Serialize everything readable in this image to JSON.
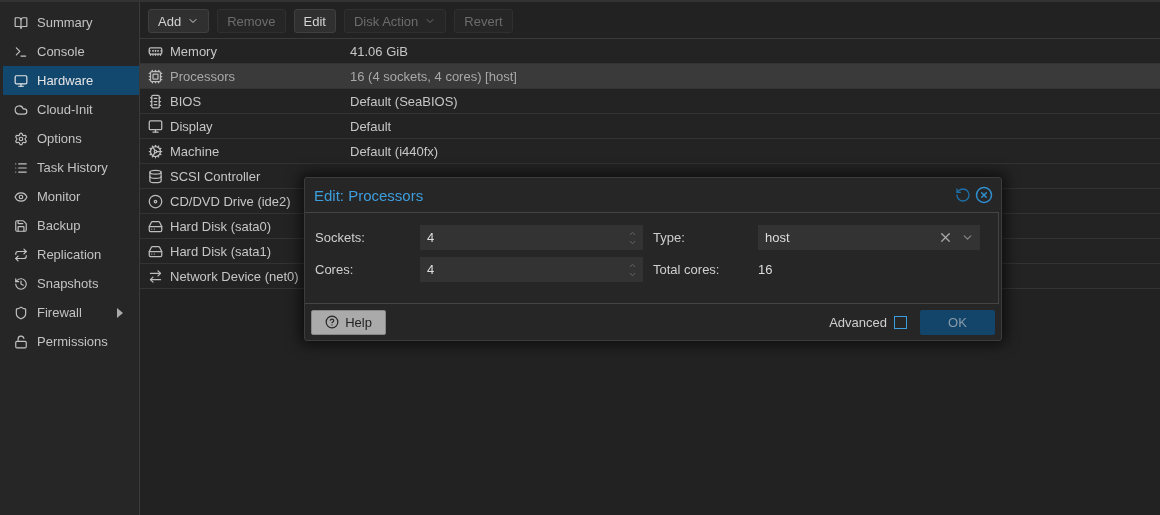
{
  "sidebar": {
    "items": [
      {
        "label": "Summary",
        "selected": false
      },
      {
        "label": "Console",
        "selected": false
      },
      {
        "label": "Hardware",
        "selected": true
      },
      {
        "label": "Cloud-Init",
        "selected": false
      },
      {
        "label": "Options",
        "selected": false
      },
      {
        "label": "Task History",
        "selected": false
      },
      {
        "label": "Monitor",
        "selected": false
      },
      {
        "label": "Backup",
        "selected": false
      },
      {
        "label": "Replication",
        "selected": false
      },
      {
        "label": "Snapshots",
        "selected": false
      },
      {
        "label": "Firewall",
        "selected": false,
        "expandable": true
      },
      {
        "label": "Permissions",
        "selected": false
      }
    ]
  },
  "toolbar": {
    "buttons": [
      {
        "label": "Add",
        "disabled": false,
        "dropdown": true
      },
      {
        "label": "Remove",
        "disabled": true,
        "dropdown": false
      },
      {
        "label": "Edit",
        "disabled": false,
        "dropdown": false
      },
      {
        "label": "Disk Action",
        "disabled": true,
        "dropdown": true
      },
      {
        "label": "Revert",
        "disabled": true,
        "dropdown": false
      }
    ]
  },
  "hardware": {
    "rows": [
      {
        "name": "Memory",
        "value": "41.06 GiB",
        "selected": false
      },
      {
        "name": "Processors",
        "value": "16 (4 sockets, 4 cores) [host]",
        "selected": true
      },
      {
        "name": "BIOS",
        "value": "Default (SeaBIOS)",
        "selected": false
      },
      {
        "name": "Display",
        "value": "Default",
        "selected": false
      },
      {
        "name": "Machine",
        "value": "Default (i440fx)",
        "selected": false
      },
      {
        "name": "SCSI Controller",
        "selected": false
      },
      {
        "name": "CD/DVD Drive (ide2)",
        "selected": false
      },
      {
        "name": "Hard Disk (sata0)",
        "selected": false
      },
      {
        "name": "Hard Disk (sata1)",
        "selected": false
      },
      {
        "name": "Network Device (net0)",
        "selected": false
      }
    ]
  },
  "dialog": {
    "title": "Edit: Processors",
    "left_fields": [
      {
        "label": "Sockets:",
        "value": "4"
      },
      {
        "label": "Cores:",
        "value": "4"
      }
    ],
    "type_field": {
      "label": "Type:",
      "value": "host"
    },
    "total_cores": {
      "label": "Total cores:",
      "value": "16"
    },
    "help_button": "Help",
    "advanced": {
      "label": "Advanced",
      "checked": false
    },
    "ok_button": {
      "label": "OK",
      "disabled": true
    }
  }
}
